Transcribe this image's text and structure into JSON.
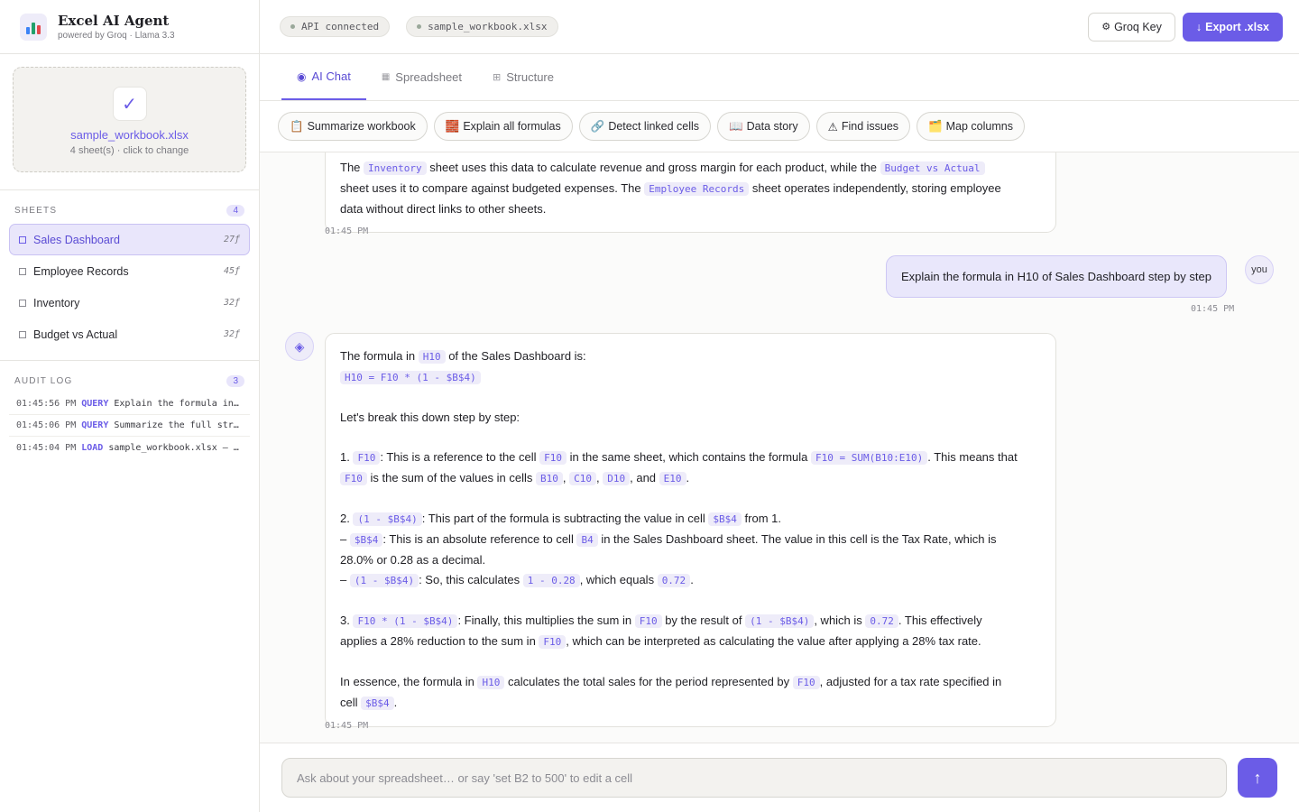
{
  "brand": {
    "title": "Excel AI Agent",
    "subtitle": "powered by Groq · Llama 3.3"
  },
  "upload": {
    "filename": "sample_workbook.xlsx",
    "subtitle": "4 sheet(s) · click to change"
  },
  "sheets": {
    "label": "SHEETS",
    "count": "4",
    "items": [
      {
        "name": "Sales Dashboard",
        "count": "27ƒ"
      },
      {
        "name": "Employee Records",
        "count": "45ƒ"
      },
      {
        "name": "Inventory",
        "count": "32ƒ"
      },
      {
        "name": "Budget vs Actual",
        "count": "32ƒ"
      }
    ]
  },
  "audit": {
    "label": "AUDIT LOG",
    "count": "3",
    "rows": [
      {
        "time": "01:45:56 PM",
        "type": "QUERY",
        "text": "Explain the formula in…"
      },
      {
        "time": "01:45:06 PM",
        "type": "QUERY",
        "text": "Summarize the full str…"
      },
      {
        "time": "01:45:04 PM",
        "type": "LOAD",
        "text": "sample_workbook.xlsx — …"
      }
    ]
  },
  "topbar": {
    "api_status": "API connected",
    "file_pill": "sample_workbook.xlsx",
    "key_label": "Groq Key",
    "export_label": "Export .xlsx"
  },
  "tabs": [
    {
      "label": "AI Chat"
    },
    {
      "label": "Spreadsheet"
    },
    {
      "label": "Structure"
    }
  ],
  "quick_actions": [
    {
      "icon": "📋",
      "label": "Summarize workbook"
    },
    {
      "icon": "🧱",
      "label": "Explain all formulas"
    },
    {
      "icon": "🔗",
      "label": "Detect linked cells"
    },
    {
      "icon": "📖",
      "label": "Data story"
    },
    {
      "icon": "⚠",
      "label": "Find issues"
    },
    {
      "icon": "🗂️",
      "label": "Map columns"
    }
  ],
  "chat": {
    "msg1": {
      "a1": "The ",
      "c1": "Inventory",
      "a2": " sheet uses this data to calculate revenue and gross margin for each product, while the ",
      "c2": "Budget vs Actual",
      "a3": " sheet uses it to compare against budgeted expenses. The ",
      "c3": "Employee Records",
      "a4": " sheet operates independently, storing employee",
      "a5": "data without direct links to other sheets.",
      "time": "01:45 PM"
    },
    "user": {
      "text": "Explain the formula in H10 of Sales Dashboard step by step",
      "avatar": "you",
      "time": "01:45 PM"
    },
    "msg2": {
      "l1a": "The formula in ",
      "l1c": "H10",
      "l1b": " of the Sales Dashboard is:",
      "l2c": "H10 = F10 * (1 - $B$4)",
      "l3": "Let's break this down step by step:",
      "s1a": "1. ",
      "s1c1": "F10",
      "s1b": ": This is a reference to the cell ",
      "s1c2": "F10",
      "s1d": " in the same sheet, which contains the formula ",
      "s1c3": "F10 = SUM(B10:E10)",
      "s1e": ". This means that",
      "s1c4": "F10",
      "s1f": " is the sum of the values in cells ",
      "s1c5": "B10",
      "s1g": ", ",
      "s1c6": "C10",
      "s1h": ", ",
      "s1c7": "D10",
      "s1i": ", and ",
      "s1c8": "E10",
      "s1j": ".",
      "s2a": "2. ",
      "s2c1": "(1 - $B$4)",
      "s2b": ": This part of the formula is subtracting the value in cell ",
      "s2c2": "$B$4",
      "s2d": " from 1.",
      "s2e": "– ",
      "s2c3": "$B$4",
      "s2f": ": This is an absolute reference to cell ",
      "s2c4": "B4",
      "s2g": " in the Sales Dashboard sheet. The value in this cell is the Tax Rate, which is",
      "s2h": "28.0% or 0.28 as a decimal.",
      "s2i": "– ",
      "s2c5": "(1 - $B$4)",
      "s2j": ": So, this calculates ",
      "s2c6": "1 - 0.28",
      "s2k": ", which equals ",
      "s2c7": "0.72",
      "s2l": ".",
      "s3a": "3. ",
      "s3c1": "F10 * (1 - $B$4)",
      "s3b": ": Finally, this multiplies the sum in ",
      "s3c2": "F10",
      "s3d": " by the result of ",
      "s3c3": "(1 - $B$4)",
      "s3e": ", which is ",
      "s3c4": "0.72",
      "s3f": ". This effectively",
      "s3g": "applies a 28% reduction to the sum in ",
      "s3c5": "F10",
      "s3h": ", which can be interpreted as calculating the value after applying a 28% tax rate.",
      "e1": "In essence, the formula in ",
      "ec1": "H10",
      "e2": " calculates the total sales for the period represented by ",
      "ec2": "F10",
      "e3": ", adjusted for a tax rate specified in",
      "e4": "cell ",
      "ec3": "$B$4",
      "e5": ".",
      "time": "01:45 PM"
    }
  },
  "composer": {
    "placeholder": "Ask about your spreadsheet… or say 'set B2 to 500' to edit a cell",
    "send_icon": "↑"
  },
  "colors": {
    "accent": "#6b5ce7",
    "status_ok": "#9aa89a"
  }
}
